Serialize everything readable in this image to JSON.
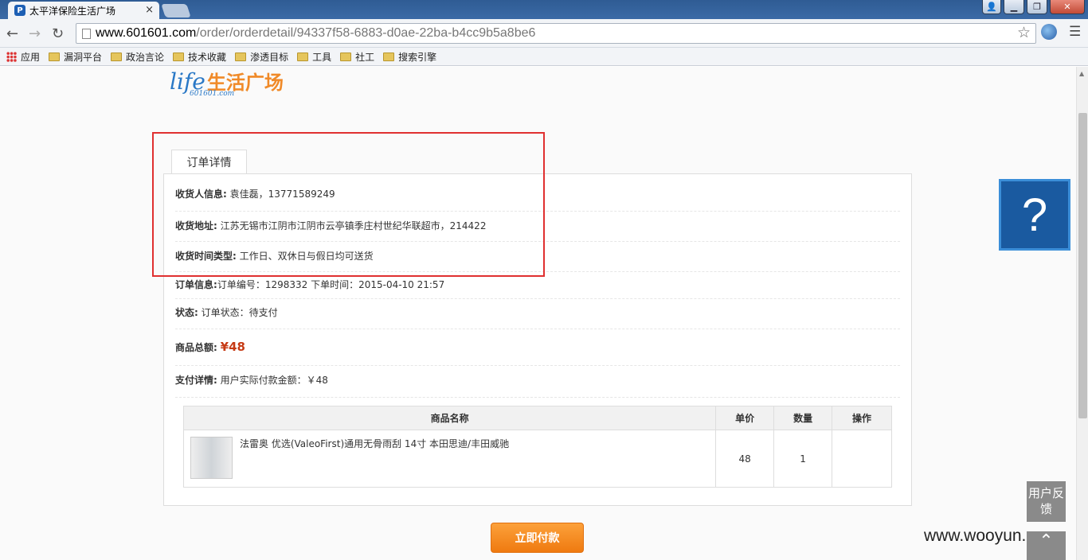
{
  "browser": {
    "tab_title": "太平洋保险生活广场",
    "url_host": "www.601601.com",
    "url_path": "/order/orderdetail/94337f58-6883-d0ae-22ba-b4cc9b5a8be6",
    "bookmarks": [
      "应用",
      "漏洞平台",
      "政治言论",
      "技术收藏",
      "渗透目标",
      "工具",
      "社工",
      "搜索引擎"
    ]
  },
  "logo": {
    "life": "life",
    "cn": "生活广场",
    "domain": "601601.com"
  },
  "order": {
    "tab_label": "订单详情",
    "receiver_label": "收货人信息:",
    "receiver_value": "袁佳磊，13771589249",
    "address_label": "收货地址:",
    "address_value": "江苏无锡市江阴市江阴市云亭镇季庄村世纪华联超市，214422",
    "time_label": "收货时间类型:",
    "time_value": "工作日、双休日与假日均可送货",
    "info_label": "订单信息:",
    "info_value": "订单编号：1298332 下单时间：2015-04-10 21:57",
    "status_label": "状态:",
    "status_value": "订单状态：待支付",
    "total_label": "商品总额:",
    "total_value": "¥48",
    "pay_label": "支付详情:",
    "pay_value": "用户实际付款金额：￥48"
  },
  "table": {
    "headers": [
      "商品名称",
      "单价",
      "数量",
      "操作"
    ],
    "rows": [
      {
        "name": "法雷奥 优选(ValeoFirst)通用无骨雨刮 14寸 本田思迪/丰田威驰",
        "price": "48",
        "qty": "1",
        "action": ""
      }
    ]
  },
  "pay_button": "立即付款",
  "help_symbol": "?",
  "feedback": "用户反馈",
  "watermark": "www.wooyun.org",
  "colors": {
    "accent": "#ef7a10",
    "price": "#c63a14",
    "highlight_box": "#e03030",
    "help_bg": "#1a5aa0"
  }
}
